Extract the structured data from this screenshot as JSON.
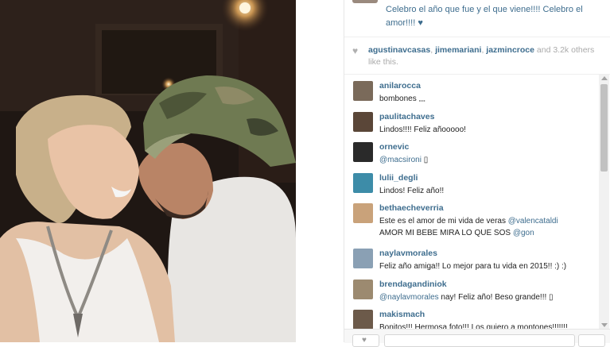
{
  "caption": {
    "text": "Celebro el año que fue y el que viene!!!! Celebro el amor!!!! ♥"
  },
  "likes": {
    "users": [
      "agustinavcasas",
      "jimemariani",
      "jazmincroce"
    ],
    "separator": ", ",
    "rest": " and 3.2k others like this.",
    "icon": "heart-icon"
  },
  "comments": [
    {
      "user": "anilarocca",
      "text": "bombones 𓈒𓈒𓈒",
      "avatar_color": "#7a6a5a"
    },
    {
      "user": "paulitachaves",
      "text": "Lindos!!!! Feliz añooooo!",
      "avatar_color": "#5a4638"
    },
    {
      "user": "ornevic",
      "text": "@macsironi",
      "suffix": " ▯",
      "avatar_color": "#2a2a2a"
    },
    {
      "user": "lulii_degli",
      "text": "Lindos! Feliz año!!",
      "avatar_color": "#3d8ca8"
    },
    {
      "user": "bethaecheverria",
      "text": "Este es el amor de mi vida de veras ",
      "mention": "@valencataldi",
      "text2": "AMOR MI BEBE MIRA LO QUE SOS ",
      "mention2": "@gon",
      "avatar_color": "#c9a27a"
    },
    {
      "user": "naylavmorales",
      "text": "Feliz año amiga!! Lo mejor para tu vida en 2015!! :) :)",
      "avatar_color": "#8aa0b4"
    },
    {
      "user": "brendagandiniok",
      "text": "@naylavmorales",
      "suffix": " nay! Feliz año! Beso grande!!! ▯",
      "avatar_color": "#9c8a70"
    },
    {
      "user": "makismach",
      "text": "Bonitos!!! Hermosa foto!!! Los quiero a montones!!!!!!!",
      "avatar_color": "#6c5a4a"
    }
  ],
  "colors": {
    "link": "#3e6d8e",
    "text": "#222222",
    "muted": "#aaaaaa"
  }
}
